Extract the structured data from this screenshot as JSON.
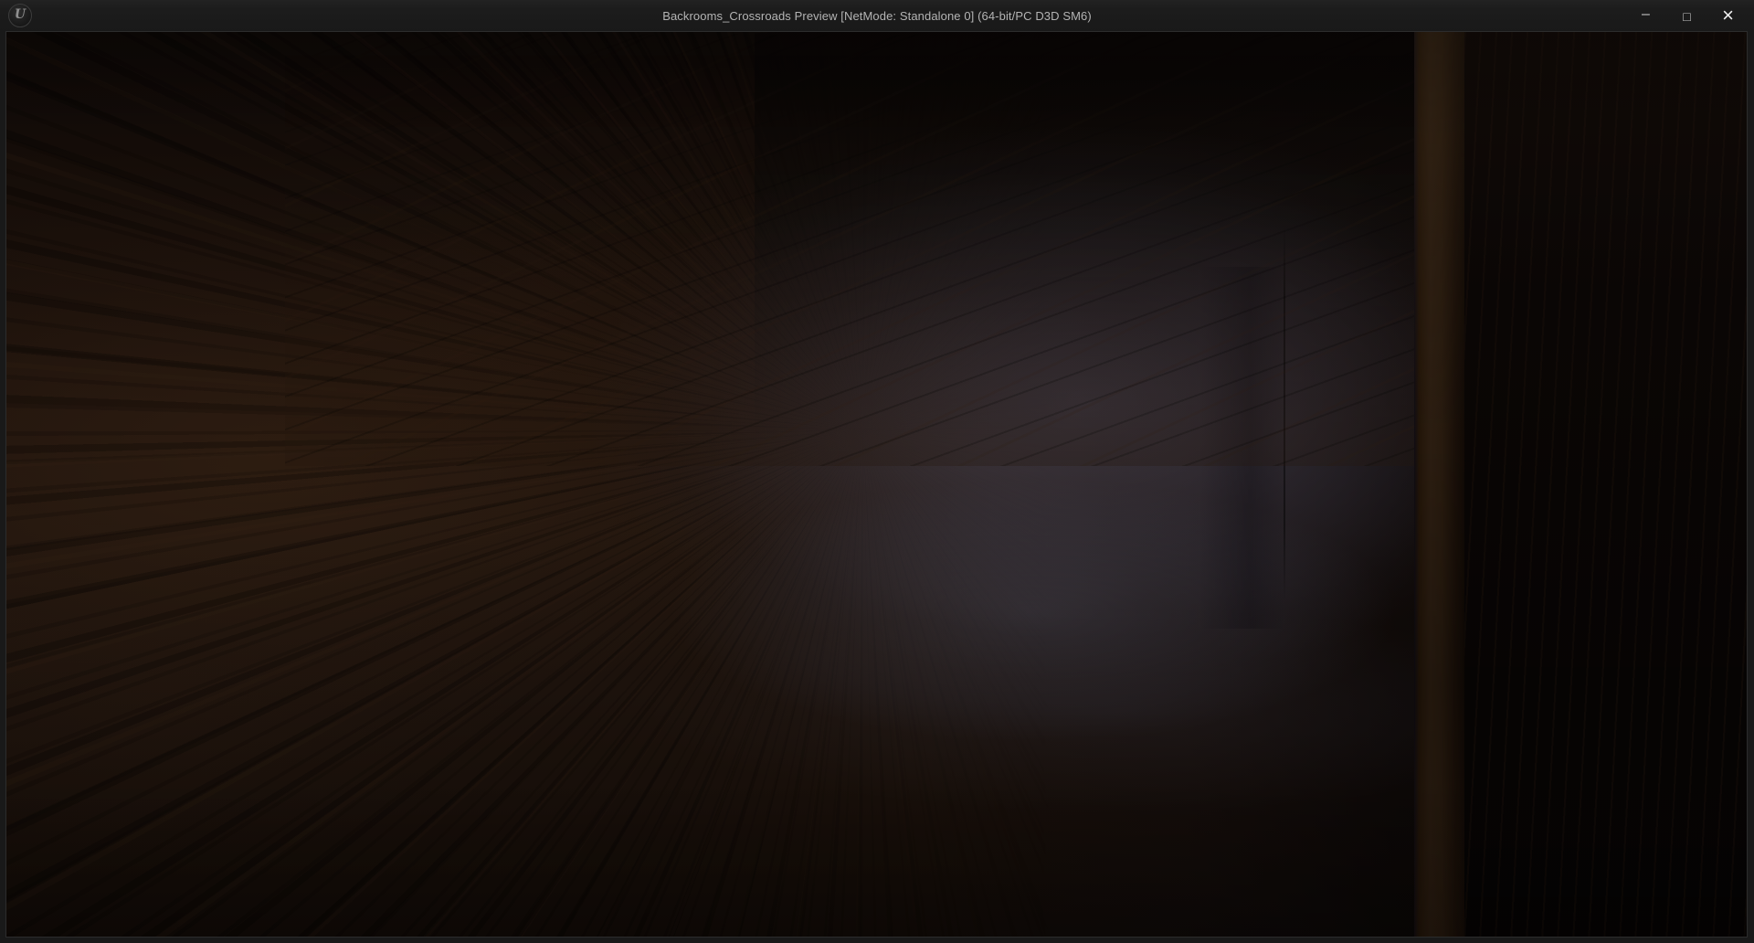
{
  "titlebar": {
    "title": "Backrooms_Crossroads Preview [NetMode: Standalone 0]  (64-bit/PC D3D SM6)",
    "logo_glyph": "U",
    "controls": {
      "minimize_glyph": "–",
      "maximize_glyph": "□",
      "close_glyph": "×"
    }
  },
  "colors": {
    "titlebar-bg": "#1c1c1c",
    "titlebar-text": "#b4b4b4",
    "control-icon": "#c9c9c9",
    "close-icon": "#f0f0f0",
    "frame": "#191919",
    "viewport-edge": "#2c2c2c",
    "wood-deep": "#130b07",
    "wood-mid": "#22150e",
    "wood-warm": "#2e1c11",
    "glow-blue": "#5a5a74",
    "floor-sheen-blue": "#4e5268",
    "doorframe-wood": "#2b1d11",
    "near-black": "#0a0605"
  }
}
